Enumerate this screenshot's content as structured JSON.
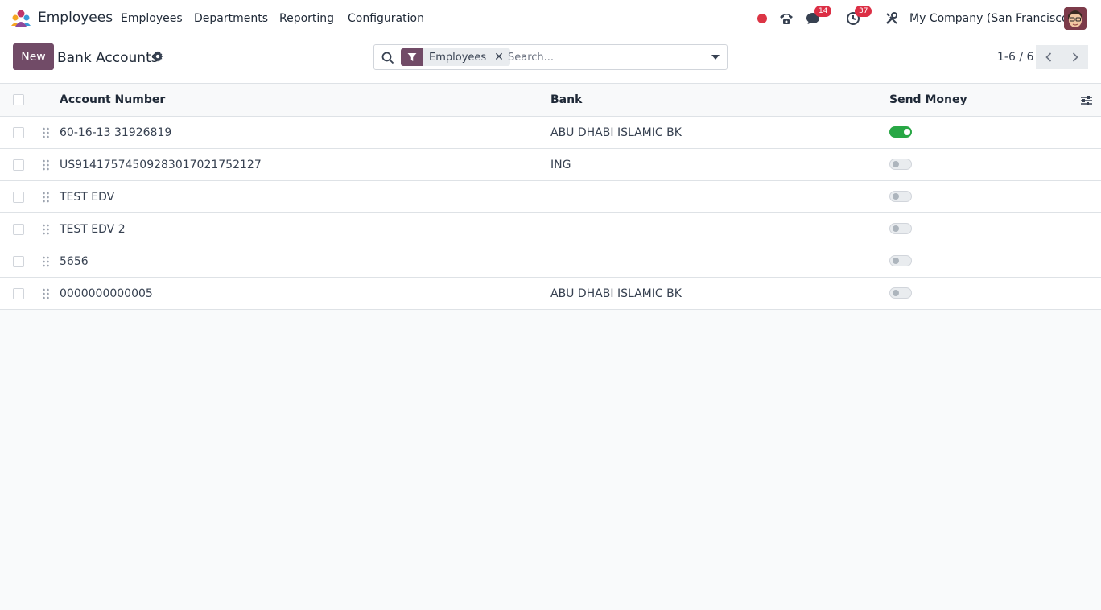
{
  "navbar": {
    "app_name": "Employees",
    "menu": [
      "Employees",
      "Departments",
      "Reporting",
      "Configuration"
    ],
    "messages_badge": "14",
    "activities_badge": "37",
    "company": "My Company (San Francisco)",
    "icons": [
      "recording-dot-icon",
      "phone-icon",
      "chat-icon",
      "clock-icon",
      "tools-icon"
    ],
    "accent": "#714b67",
    "status_red": "#dc2f45"
  },
  "control": {
    "new_label": "New",
    "title": "Bank Accounts",
    "facet_label": "Employees",
    "search_placeholder": "Search...",
    "pager": "1-6 / 6"
  },
  "table": {
    "columns": [
      "Account Number",
      "Bank",
      "Send Money"
    ],
    "rows": [
      {
        "account": "60-16-13 31926819",
        "bank": "ABU DHABI ISLAMIC BK",
        "send_money": true
      },
      {
        "account": "US91417574509283017021752127",
        "bank": "ING",
        "send_money": false
      },
      {
        "account": "TEST EDV",
        "bank": "",
        "send_money": false
      },
      {
        "account": "TEST EDV 2",
        "bank": "",
        "send_money": false
      },
      {
        "account": "5656",
        "bank": "",
        "send_money": false
      },
      {
        "account": "0000000000005",
        "bank": "ABU DHABI ISLAMIC BK",
        "send_money": false
      }
    ],
    "toggle_on_color": "#28a745"
  }
}
